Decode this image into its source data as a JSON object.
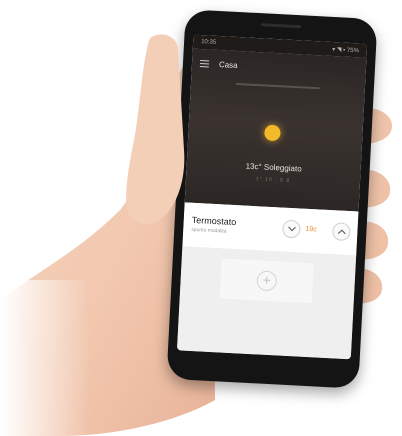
{
  "status": {
    "time": "10:35",
    "icons": "▾ ◥ ▪ 75%"
  },
  "app": {
    "title": "Casa",
    "menu_icon": "menu-icon"
  },
  "weather": {
    "icon": "sun-icon",
    "summary": "13c° Soleggiato",
    "details": "1° 10 · 8 8"
  },
  "thermostat": {
    "title": "Termostato",
    "subtitle": "spunto modalità",
    "set_temperature": "19c",
    "down_icon": "chevron-down-icon",
    "up_icon": "chevron-up-icon"
  },
  "add_tile": {
    "label": "+"
  },
  "colors": {
    "hero": "#2b2624",
    "sun": "#f3b92b",
    "accent": "#f08a2c",
    "phone": "#141414",
    "skin": "#f2c9b1"
  }
}
